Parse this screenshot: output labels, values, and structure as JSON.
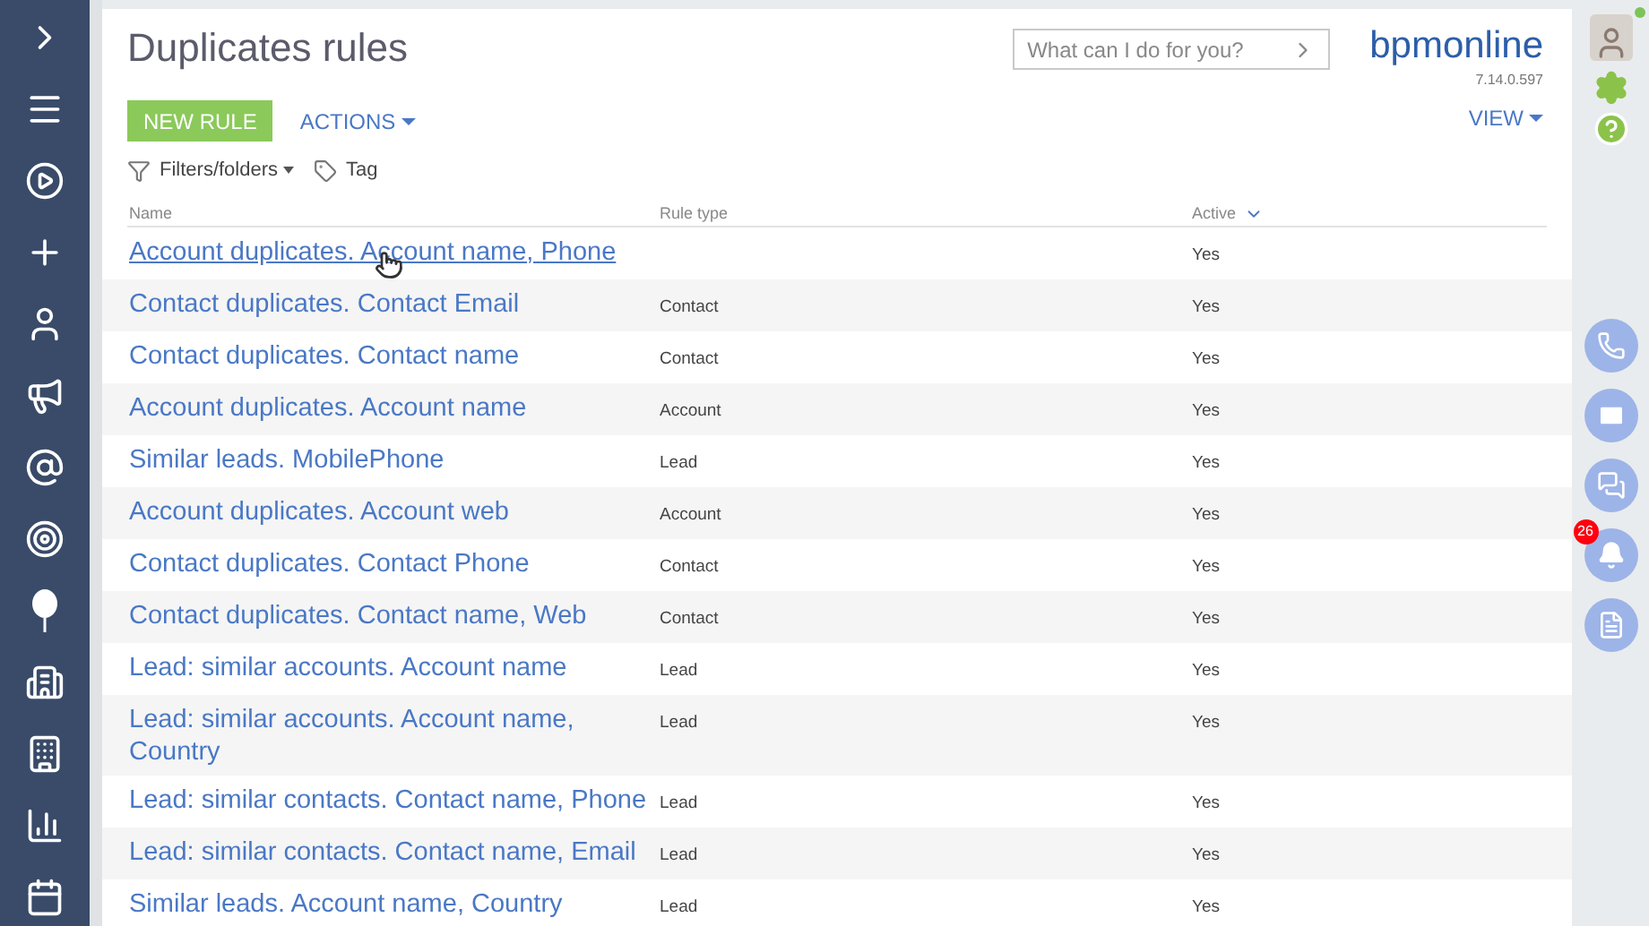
{
  "page": {
    "title": "Duplicates rules"
  },
  "toolbar": {
    "primary_button": "NEW RULE",
    "actions_menu": "ACTIONS",
    "view_menu": "VIEW"
  },
  "search": {
    "placeholder": "What can I do for you?"
  },
  "brand": {
    "logo": "bpmonline",
    "version": "7.14.0.597"
  },
  "filters": {
    "filters_folders": "Filters/folders",
    "tag": "Tag"
  },
  "table": {
    "columns": [
      {
        "label": "Name",
        "sorted": false
      },
      {
        "label": "Rule type",
        "sorted": false
      },
      {
        "label": "Active",
        "sorted": true
      }
    ],
    "rows": [
      {
        "name": "Account duplicates. Account name, Phone",
        "rule_type": "",
        "active": "Yes",
        "hovered": true
      },
      {
        "name": "Contact duplicates. Contact Email",
        "rule_type": "Contact",
        "active": "Yes",
        "hovered": false
      },
      {
        "name": "Contact duplicates. Contact name",
        "rule_type": "Contact",
        "active": "Yes",
        "hovered": false
      },
      {
        "name": "Account duplicates. Account name",
        "rule_type": "Account",
        "active": "Yes",
        "hovered": false
      },
      {
        "name": "Similar leads. MobilePhone",
        "rule_type": "Lead",
        "active": "Yes",
        "hovered": false
      },
      {
        "name": "Account duplicates. Account web",
        "rule_type": "Account",
        "active": "Yes",
        "hovered": false
      },
      {
        "name": "Contact duplicates. Contact Phone",
        "rule_type": "Contact",
        "active": "Yes",
        "hovered": false
      },
      {
        "name": "Contact duplicates. Contact name, Web",
        "rule_type": "Contact",
        "active": "Yes",
        "hovered": false
      },
      {
        "name": "Lead: similar accounts. Account name",
        "rule_type": "Lead",
        "active": "Yes",
        "hovered": false
      },
      {
        "name": "Lead: similar accounts. Account name, Country",
        "rule_type": "Lead",
        "active": "Yes",
        "hovered": false
      },
      {
        "name": "Lead: similar contacts. Contact name, Phone",
        "rule_type": "Lead",
        "active": "Yes",
        "hovered": false
      },
      {
        "name": "Lead: similar contacts. Contact name, Email",
        "rule_type": "Lead",
        "active": "Yes",
        "hovered": false
      },
      {
        "name": "Similar leads. Account name, Country",
        "rule_type": "Lead",
        "active": "Yes",
        "hovered": false
      }
    ]
  },
  "right_panel": {
    "notifications_badge": "26"
  }
}
